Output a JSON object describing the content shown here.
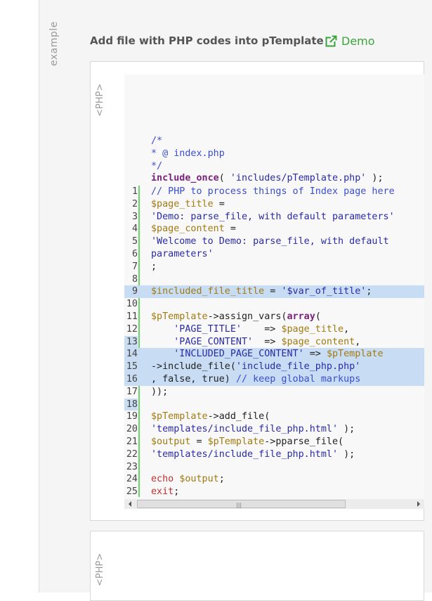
{
  "side_label": "example",
  "title": "Add file with PHP codes into pTemplate",
  "demo_link": "Demo",
  "box1": {
    "lang": "<PHP>",
    "header_lines": [
      [
        {
          "t": "/*",
          "c": "com"
        }
      ],
      [
        {
          "t": "* @ index.php",
          "c": "com"
        }
      ],
      [
        {
          "t": "*/",
          "c": "com"
        }
      ],
      [
        {
          "t": "include_once",
          "c": "kw"
        },
        {
          "t": "( ",
          "c": "fn"
        },
        {
          "t": "'includes/pTemplate.php'",
          "c": "str"
        },
        {
          "t": " );",
          "c": "fn"
        }
      ]
    ],
    "lines": [
      {
        "n": "1",
        "s": [
          {
            "t": "// PHP to process things of Index page here",
            "c": "com"
          }
        ]
      },
      {
        "n": "2",
        "s": [
          {
            "t": "$page_title",
            "c": "var"
          },
          {
            "t": " =",
            "c": "fn"
          }
        ]
      },
      {
        "n": "3",
        "s": [
          {
            "t": "'Demo: parse_file, with default parameters'",
            "c": "str"
          }
        ]
      },
      {
        "n": "4",
        "s": [
          {
            "t": "$page_content",
            "c": "var"
          },
          {
            "t": " =",
            "c": "fn"
          }
        ]
      },
      {
        "n": "5",
        "s": [
          {
            "t": "'Welcome to Demo: parse_file, with default",
            "c": "str"
          }
        ]
      },
      {
        "n": "6",
        "s": [
          {
            "t": "parameters'",
            "c": "str"
          }
        ]
      },
      {
        "n": "7",
        "s": [
          {
            "t": ";",
            "c": "fn"
          }
        ]
      },
      {
        "n": "8",
        "s": []
      },
      {
        "n": "9",
        "hl": true,
        "s": [
          {
            "t": "$included_file_title",
            "c": "var"
          },
          {
            "t": " = ",
            "c": "fn"
          },
          {
            "t": "'$var_of_title'",
            "c": "str"
          },
          {
            "t": ";",
            "c": "fn"
          }
        ]
      },
      {
        "n": "10",
        "s": []
      },
      {
        "n": "11",
        "s": [
          {
            "t": "$pTemplate",
            "c": "var"
          },
          {
            "t": "->assign_vars(",
            "c": "fn"
          },
          {
            "t": "array",
            "c": "kw"
          },
          {
            "t": "(",
            "c": "fn"
          }
        ]
      },
      {
        "n": "12",
        "s": [
          {
            "t": "    ",
            "c": "fn"
          },
          {
            "t": "'PAGE_TITLE'",
            "c": "str"
          },
          {
            "t": "    => ",
            "c": "fn"
          },
          {
            "t": "$page_title",
            "c": "var"
          },
          {
            "t": ",",
            "c": "fn"
          }
        ]
      },
      {
        "n": "13",
        "hlnum": true,
        "s": [
          {
            "t": "    ",
            "c": "fn"
          },
          {
            "t": "'PAGE_CONTENT'",
            "c": "str"
          },
          {
            "t": "  => ",
            "c": "fn"
          },
          {
            "t": "$page_content",
            "c": "var"
          },
          {
            "t": ",",
            "c": "fn"
          }
        ]
      },
      {
        "n": "14",
        "hl": true,
        "s": [
          {
            "t": "    ",
            "c": "fn"
          },
          {
            "t": "'INCLUDED_PAGE_CONTENT'",
            "c": "str"
          },
          {
            "t": " => ",
            "c": "fn"
          },
          {
            "t": "$pTemplate",
            "c": "var"
          }
        ]
      },
      {
        "n": "15",
        "hl": true,
        "s": [
          {
            "t": "->include_file(",
            "c": "fn"
          },
          {
            "t": "'include_file_php.php'",
            "c": "str"
          }
        ]
      },
      {
        "n": "16",
        "hl": true,
        "s": [
          {
            "t": ", false, true) ",
            "c": "fn"
          },
          {
            "t": "// keep global markups",
            "c": "com"
          }
        ]
      },
      {
        "n": "17",
        "s": [
          {
            "t": "));",
            "c": "fn"
          }
        ]
      },
      {
        "n": "18",
        "hlnum": true,
        "s": []
      },
      {
        "n": "19",
        "s": [
          {
            "t": "$pTemplate",
            "c": "var"
          },
          {
            "t": "->add_file(",
            "c": "fn"
          }
        ]
      },
      {
        "n": "20",
        "s": [
          {
            "t": "'templates/include_file_php.html'",
            "c": "str"
          },
          {
            "t": " );",
            "c": "fn"
          }
        ]
      },
      {
        "n": "21",
        "s": [
          {
            "t": "$output",
            "c": "var"
          },
          {
            "t": " = ",
            "c": "fn"
          },
          {
            "t": "$pTemplate",
            "c": "var"
          },
          {
            "t": "->pparse_file(",
            "c": "fn"
          }
        ]
      },
      {
        "n": "22",
        "s": [
          {
            "t": "'templates/include_file_php.html'",
            "c": "str"
          },
          {
            "t": " );",
            "c": "fn"
          }
        ]
      },
      {
        "n": "23",
        "s": []
      },
      {
        "n": "24",
        "s": [
          {
            "t": "echo",
            "c": "red"
          },
          {
            "t": " ",
            "c": "fn"
          },
          {
            "t": "$output",
            "c": "var"
          },
          {
            "t": ";",
            "c": "fn"
          }
        ]
      },
      {
        "n": "25",
        "s": [
          {
            "t": "exit",
            "c": "red"
          },
          {
            "t": ";",
            "c": "fn"
          }
        ]
      }
    ],
    "scroll_grip": "|||"
  },
  "box2": {
    "lang": "<PHP>"
  },
  "colors": {
    "accent_green": "#3aa43a",
    "gutter_bar": "#6ad36a",
    "highlight": "#c8dcf4"
  },
  "icons": {
    "demo": "external-link-icon"
  }
}
